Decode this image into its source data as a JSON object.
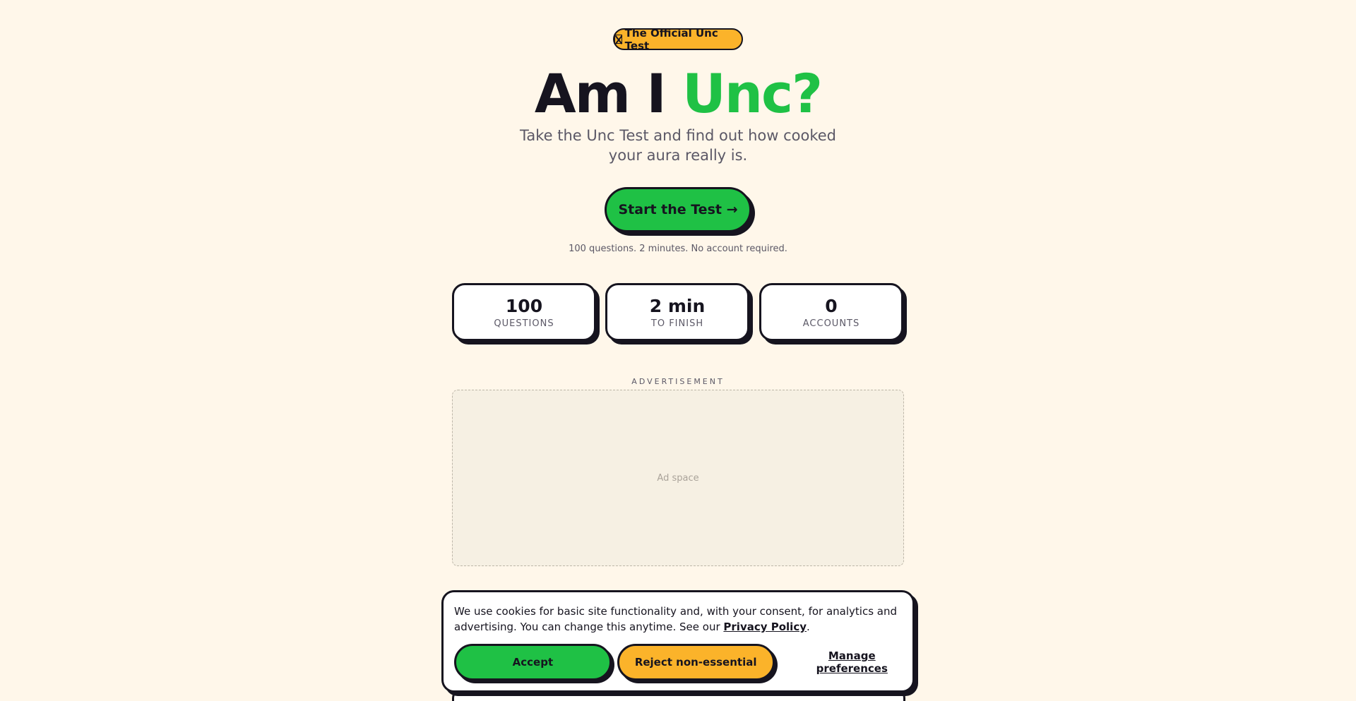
{
  "badge": {
    "icon": "hourglass-icon",
    "text": "The Official Unc Test"
  },
  "hero": {
    "title_plain": "Am I ",
    "title_accent": "Unc?",
    "subtitle": "Take the Unc Test and find out how cooked your aura really is."
  },
  "cta": {
    "label": "Start the Test →",
    "note": "100 questions. 2 minutes. No account required."
  },
  "stats": [
    {
      "value": "100",
      "label": "QUESTIONS"
    },
    {
      "value": "2 min",
      "label": "TO FINISH"
    },
    {
      "value": "0",
      "label": "ACCOUNTS"
    }
  ],
  "ad": {
    "label": "ADVERTISEMENT",
    "placeholder": "Ad space"
  },
  "cookie_banner": {
    "text_before": "We use cookies for basic site functionality and, with your consent, for analytics and advertising. You can change this anytime. See our ",
    "policy_link": "Privacy Policy",
    "text_after": ".",
    "accept_label": "Accept",
    "reject_label": "Reject non-essential",
    "manage_label": "Manage preferences"
  },
  "colors": {
    "background": "#fff7ea",
    "accent_green": "#1fc145",
    "accent_yellow": "#fbb32a",
    "ink": "#16141f"
  }
}
